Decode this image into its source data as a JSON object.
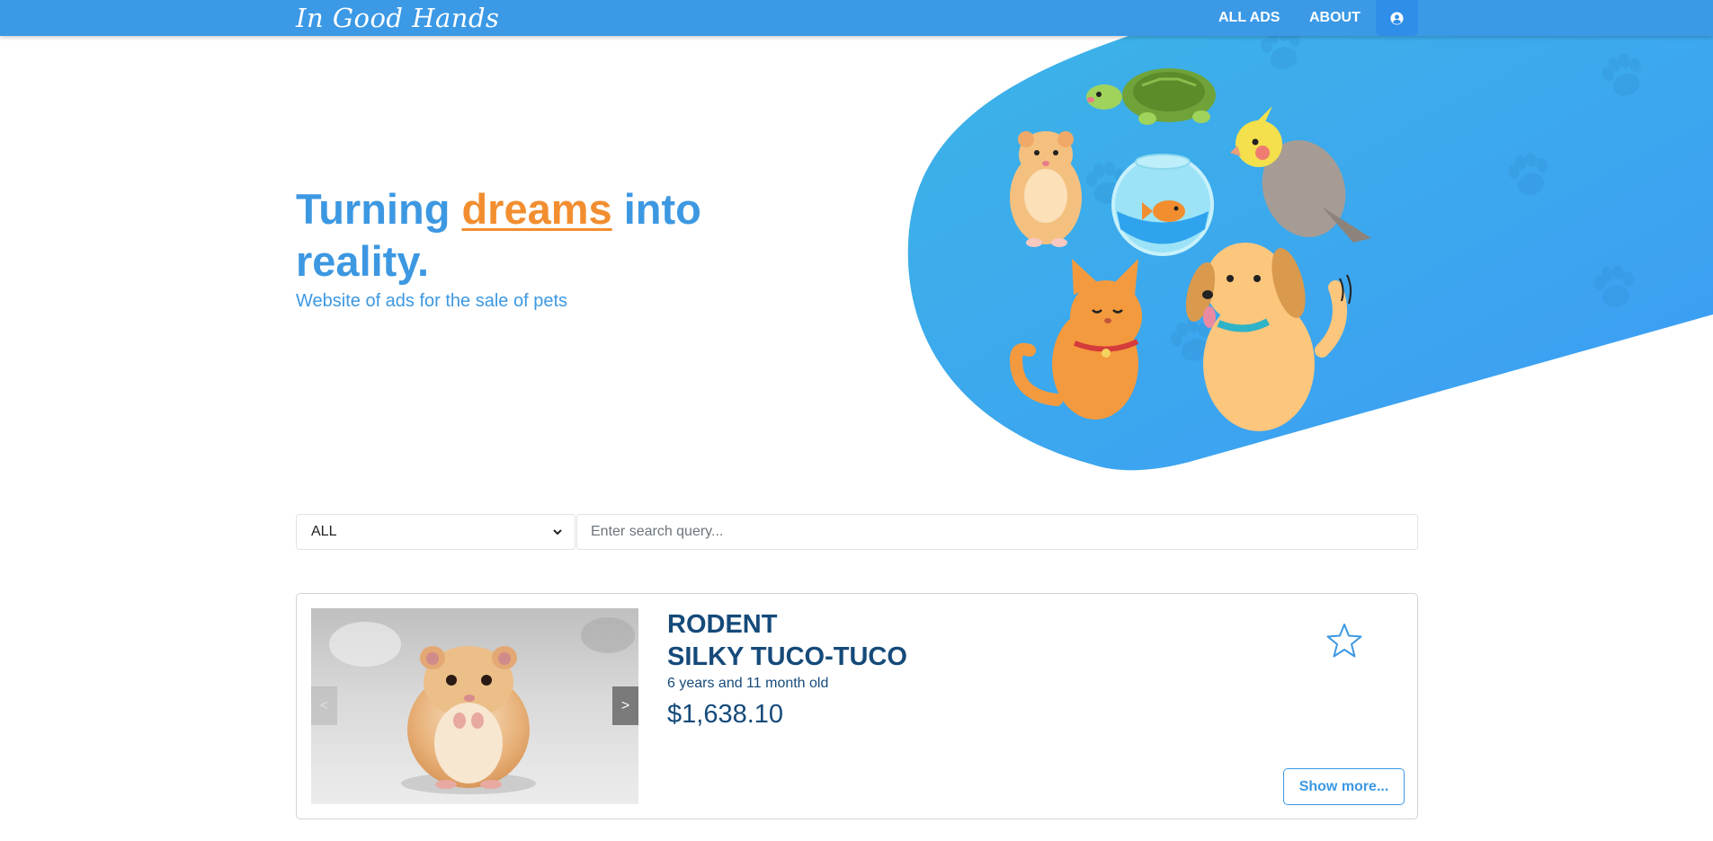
{
  "navbar": {
    "brand": "In Good Hands",
    "links": [
      {
        "label": "ALL ADS"
      },
      {
        "label": "ABOUT"
      }
    ],
    "user_icon": "user-circle-icon"
  },
  "hero": {
    "title_part1": "Turning ",
    "title_accent": "dreams",
    "title_part2": " into reality.",
    "subtitle": "Website of ads for the sale of pets",
    "illustration_icons": [
      "turtle-icon",
      "hamster-icon",
      "fishbowl-icon",
      "cockatiel-icon",
      "cat-icon",
      "dog-icon",
      "paw-print-icon"
    ],
    "colors": {
      "primary": "#3d98e2",
      "accent": "#f28e2f"
    }
  },
  "filters": {
    "category_selected": "ALL",
    "search_placeholder": "Enter search query..."
  },
  "ads": [
    {
      "category": "RODENT",
      "name": "SILKY TUCO-TUCO",
      "age": "6 years and 11 month old",
      "price": "$1,638.10",
      "prev_label": "<",
      "next_label": ">",
      "show_more_label": "Show more...",
      "favorite_icon": "star-outline-icon"
    }
  ]
}
